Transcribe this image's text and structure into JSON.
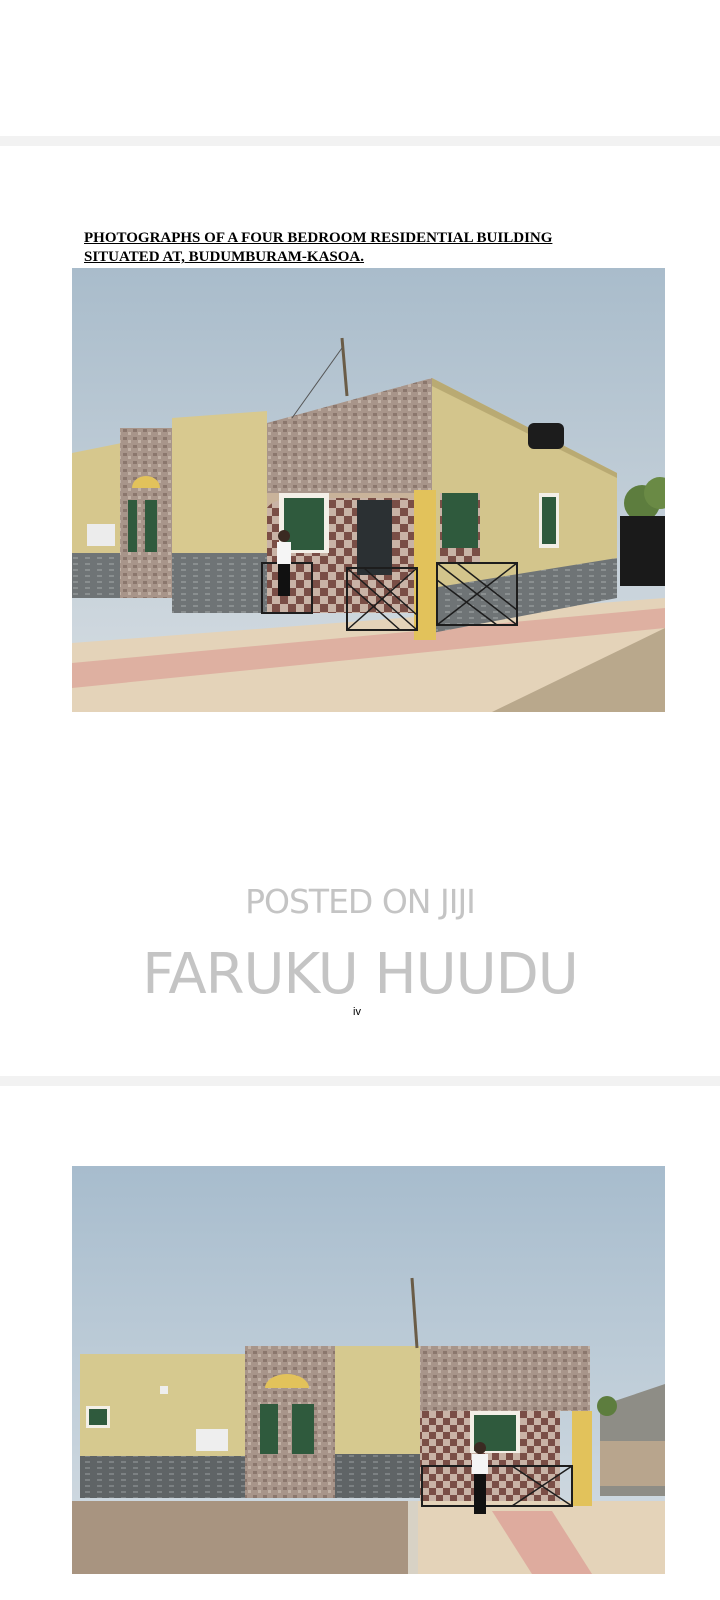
{
  "pages": [
    {
      "heading_lines": [
        "PHOTOGRAPHS OF A FOUR BEDROOM RESIDENTIAL BUILDING",
        "SITUATED AT, BUDUMBURAM-KASOA."
      ],
      "watermark": {
        "line1": "POSTED ON JIJI",
        "line2": "FARUKU HUUDU"
      },
      "page_number": "iv"
    }
  ],
  "colors": {
    "sky": "#b9c9d6",
    "wall": "#d8c98f",
    "stone": "#9d8a7e",
    "pillar": "#e2c25b",
    "paving": "#e6d4b9",
    "paving_red": "#d9928a",
    "watermark": "#c4c4c4"
  }
}
